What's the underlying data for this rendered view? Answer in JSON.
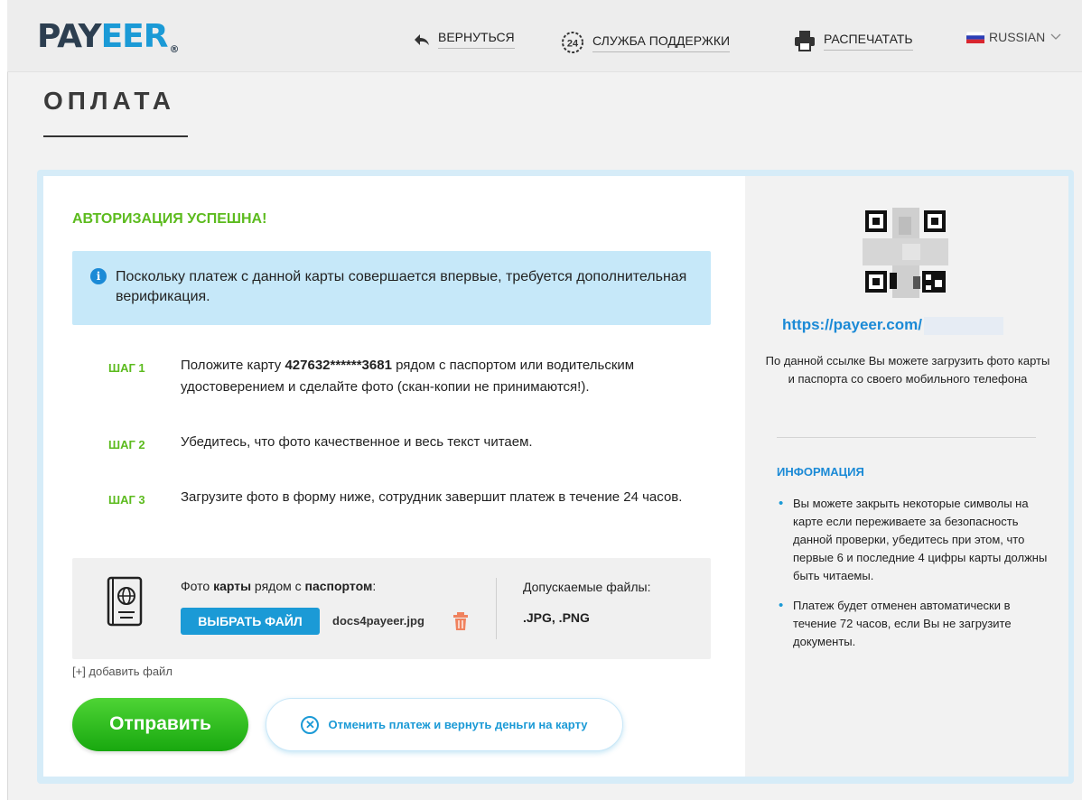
{
  "brand": {
    "logo_dark": "PAY",
    "logo_blue": "EER",
    "logo_reg": "®"
  },
  "nav": {
    "back": "ВЕРНУТЬСЯ",
    "support": "СЛУЖБА ПОДДЕРЖКИ",
    "support_badge": "24",
    "print": "РАСПЕЧАТАТЬ",
    "language": "RUSSIAN"
  },
  "page": {
    "title": "ОПЛАТА"
  },
  "main": {
    "success": "АВТОРИЗАЦИЯ УСПЕШНА!",
    "notice": "Поскольку платеж с данной карты совершается впервые, требуется дополнительная верификация.",
    "steps": [
      {
        "label": "ШАГ 1",
        "text_before": "Положите карту ",
        "card": "427632******3681",
        "text_after": " рядом с паспортом или водительским удостоверением и сделайте фото (скан-копии не принимаются!)."
      },
      {
        "label": "ШАГ 2",
        "text": "Убедитесь, что фото качественное и весь текст читаем."
      },
      {
        "label": "ШАГ 3",
        "text": "Загрузите фото в форму ниже, сотрудник завершит платеж в течение 24 часов."
      }
    ],
    "upload": {
      "caption_1": "Фото ",
      "caption_b1": "карты",
      "caption_2": " рядом с ",
      "caption_b2": "паспортом",
      "caption_3": ":",
      "choose_file": "ВЫБРАТЬ ФАЙЛ",
      "file_name": "docs4payeer.jpg",
      "allowed_label": "Допускаемые файлы:",
      "allowed_ext": ".JPG, .PNG"
    },
    "add_file": "[+] добавить файл",
    "send": "Отправить",
    "cancel": "Отменить платеж и вернуть деньги на карту"
  },
  "side": {
    "link": "https://payeer.com/",
    "description": "По данной ссылке Вы можете загрузить фото карты и паспорта со своего мобильного телефона",
    "info_title": "ИНФОРМАЦИЯ",
    "info_items": [
      "Вы можете закрыть некоторые символы на карте если переживаете за безопасность данной проверки, убедитесь при этом, что первые 6 и последние 4 цифры карты должны быть читаемы.",
      "Платеж будет отменен автоматически в течение 72 часов, если Вы не загрузите документы."
    ]
  },
  "colors": {
    "accent_blue": "#1b9ad6",
    "success_green": "#5cbb1e",
    "notice_bg": "#c6e8f9",
    "send_green": "#22b016"
  }
}
